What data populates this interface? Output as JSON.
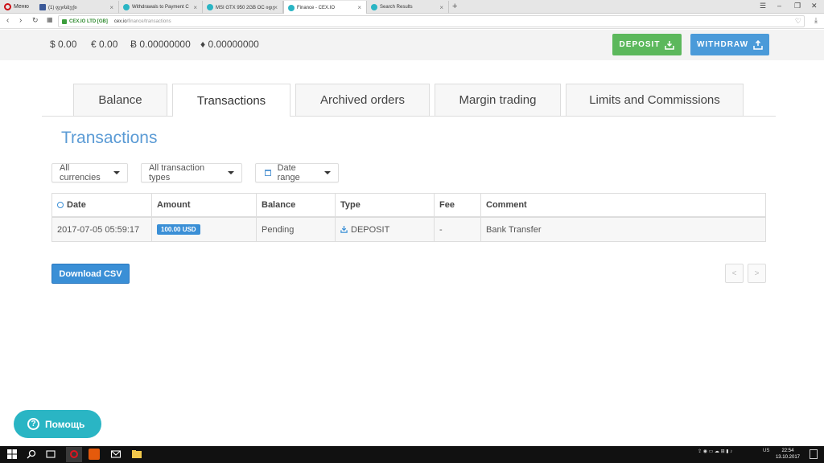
{
  "browser": {
    "menu_label": "Меню",
    "tabs": [
      {
        "label": "(1) ფეისბუქი",
        "color": "#3b5998"
      },
      {
        "label": "Withdrawals to Payment C",
        "color": "#2ab5c4"
      },
      {
        "label": "MSI GTX 950 2GB OC იდე",
        "color": "#2ab5c4"
      },
      {
        "label": "Finance - CEX.IO",
        "color": "#2ab5c4"
      },
      {
        "label": "Search Results",
        "color": "#2ab5c4"
      }
    ],
    "cert_label": "CEX.IO LTD [GB]",
    "url_host": "cex.io",
    "url_path": "/finance/transactions"
  },
  "balances": [
    {
      "label": "$ 0.00"
    },
    {
      "label": "€ 0.00"
    },
    {
      "label": "Ƀ 0.00000000"
    },
    {
      "label": "♦  0.00000000"
    }
  ],
  "actions": {
    "deposit": "DEPOSIT",
    "withdraw": "WITHDRAW",
    "deposit_color": "#5cb85c",
    "withdraw_color": "#4a9ad9"
  },
  "tabs": [
    "Balance",
    "Transactions",
    "Archived orders",
    "Margin trading",
    "Limits and Commissions"
  ],
  "page_title": "Transactions",
  "filters": {
    "currencies": "All currencies",
    "types": "All transaction types",
    "date": "Date range"
  },
  "table": {
    "headers": [
      "Date",
      "Amount",
      "Balance",
      "Type",
      "Fee",
      "Comment"
    ],
    "rows": [
      {
        "date": "2017-07-05 05:59:17",
        "amount": "100.00 USD",
        "balance": "Pending",
        "type": "DEPOSIT",
        "fee": "-",
        "comment": "Bank Transfer"
      }
    ]
  },
  "download_csv": "Download CSV",
  "pager": {
    "prev": "<",
    "next": ">"
  },
  "help_label": "Помощь",
  "taskbar": {
    "time": "22:54",
    "date": "13.10.2017",
    "lang": "US"
  }
}
